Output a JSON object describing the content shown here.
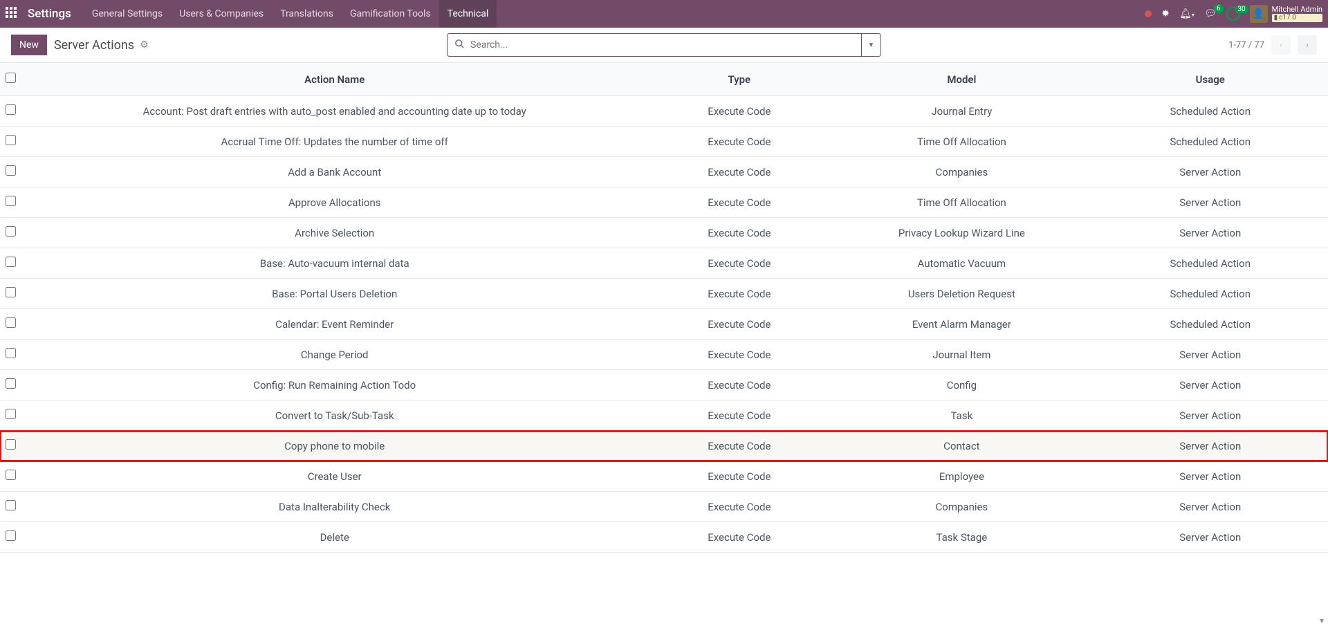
{
  "nav": {
    "brand": "Settings",
    "menus": [
      "General Settings",
      "Users & Companies",
      "Translations",
      "Gamification Tools",
      "Technical"
    ],
    "active_menu": 4,
    "msg_badge": "6",
    "timer_badge": "30",
    "username": "Mitchell Admin",
    "db": "c17.0"
  },
  "ctrl": {
    "new_label": "New",
    "breadcrumb": "Server Actions",
    "search_placeholder": "Search...",
    "pager": "1-77 / 77"
  },
  "columns": [
    "Action Name",
    "Type",
    "Model",
    "Usage"
  ],
  "rows": [
    {
      "name": "Account: Post draft entries with auto_post enabled and accounting date up to today",
      "type": "Execute Code",
      "model": "Journal Entry",
      "usage": "Scheduled Action"
    },
    {
      "name": "Accrual Time Off: Updates the number of time off",
      "type": "Execute Code",
      "model": "Time Off Allocation",
      "usage": "Scheduled Action"
    },
    {
      "name": "Add a Bank Account",
      "type": "Execute Code",
      "model": "Companies",
      "usage": "Server Action"
    },
    {
      "name": "Approve Allocations",
      "type": "Execute Code",
      "model": "Time Off Allocation",
      "usage": "Server Action"
    },
    {
      "name": "Archive Selection",
      "type": "Execute Code",
      "model": "Privacy Lookup Wizard Line",
      "usage": "Server Action"
    },
    {
      "name": "Base: Auto-vacuum internal data",
      "type": "Execute Code",
      "model": "Automatic Vacuum",
      "usage": "Scheduled Action"
    },
    {
      "name": "Base: Portal Users Deletion",
      "type": "Execute Code",
      "model": "Users Deletion Request",
      "usage": "Scheduled Action"
    },
    {
      "name": "Calendar: Event Reminder",
      "type": "Execute Code",
      "model": "Event Alarm Manager",
      "usage": "Scheduled Action"
    },
    {
      "name": "Change Period",
      "type": "Execute Code",
      "model": "Journal Item",
      "usage": "Server Action"
    },
    {
      "name": "Config: Run Remaining Action Todo",
      "type": "Execute Code",
      "model": "Config",
      "usage": "Server Action"
    },
    {
      "name": "Convert to Task/Sub-Task",
      "type": "Execute Code",
      "model": "Task",
      "usage": "Server Action"
    },
    {
      "name": "Copy phone to mobile",
      "type": "Execute Code",
      "model": "Contact",
      "usage": "Server Action",
      "hl": true
    },
    {
      "name": "Create User",
      "type": "Execute Code",
      "model": "Employee",
      "usage": "Server Action"
    },
    {
      "name": "Data Inalterability Check",
      "type": "Execute Code",
      "model": "Companies",
      "usage": "Server Action"
    },
    {
      "name": "Delete",
      "type": "Execute Code",
      "model": "Task Stage",
      "usage": "Server Action"
    }
  ]
}
